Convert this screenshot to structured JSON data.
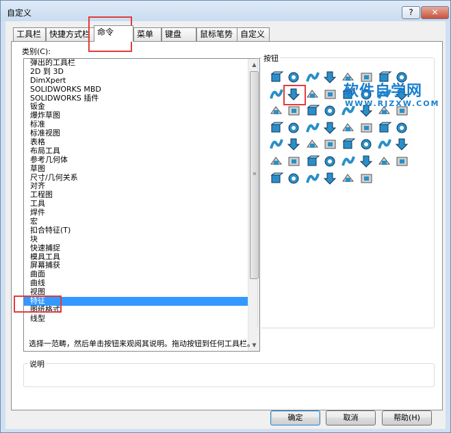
{
  "window": {
    "title": "自定义",
    "help_label": "?",
    "close_label": "✕"
  },
  "tabs": [
    {
      "label": "工具栏"
    },
    {
      "label": "快捷方式栏"
    },
    {
      "label": "命令"
    },
    {
      "label": "菜单"
    },
    {
      "label": "键盘"
    },
    {
      "label": "鼠标笔势"
    },
    {
      "label": "自定义"
    }
  ],
  "categories": {
    "label": "类别(C):",
    "selected": "特征",
    "items": [
      "弹出的工具栏",
      "2D 到 3D",
      "DimXpert",
      "SOLIDWORKS MBD",
      "SOLIDWORKS 插件",
      "钣金",
      "爆炸草图",
      "标准",
      "标准视图",
      "表格",
      "布局工具",
      "参考几何体",
      "草图",
      "尺寸/几何关系",
      "对齐",
      "工程图",
      "工具",
      "焊件",
      "宏",
      "扣合特征(T)",
      "块",
      "快速捕捉",
      "模具工具",
      "屏幕捕获",
      "曲面",
      "曲线",
      "视图",
      "特征",
      "图纸格式",
      "线型"
    ]
  },
  "buttons": {
    "label": "按钮",
    "icons": [
      "extruded-boss-icon",
      "revolved-boss-icon",
      "swept-boss-icon",
      "lofted-boss-icon",
      "boundary-boss-icon",
      "extruded-cut-icon",
      "hole-wizard-icon",
      "revolved-cut-icon",
      "swept-cut-icon",
      "lofted-cut-icon",
      "boundary-cut-icon",
      "fillet-icon",
      "chamfer-icon",
      "rib-icon",
      "draft-icon",
      "shell-icon",
      "wrap-icon",
      "intersect-icon",
      "dome-icon",
      "linear-pattern-icon",
      "circular-pattern-icon",
      "mirror-icon",
      "curve-pattern-icon",
      "sketch-pattern-icon",
      "table-pattern-icon",
      "fill-pattern-icon",
      "variable-pattern-icon",
      "rotate-icon",
      "move-copy-icon",
      "delete-face-icon",
      "combine-icon",
      "split-icon",
      "thicken-icon",
      "flex-icon",
      "indent-icon",
      "scale-icon",
      "freeform-icon",
      "deform-icon",
      "move-face-icon",
      "imported-icon",
      "reference-plane-icon",
      "axis-icon",
      "coordinate-system-icon",
      "point-icon",
      "mate-reference-icon",
      "instant3d-icon",
      "suppress-icon",
      "unsuppress-icon",
      "rollback-icon",
      "cosmetic-thread-icon",
      "library-feature-icon",
      "check-icon",
      "feature-works-icon",
      "3d-texture-icon"
    ]
  },
  "watermark": {
    "main": "软件自学网",
    "sub": "WWW.RJZXW.COM"
  },
  "hint": "选择一范畴，然后单击按钮来观阅其说明。拖动按钮到任何工具栏。",
  "description": {
    "label": "说明",
    "text": ""
  },
  "footer": {
    "ok_label": "确定",
    "cancel_label": "取消",
    "help_label": "帮助(H)"
  },
  "colors": {
    "selection": "#3399ff",
    "icon_blue": "#2a8fc7",
    "highlight": "#e23a3a"
  }
}
